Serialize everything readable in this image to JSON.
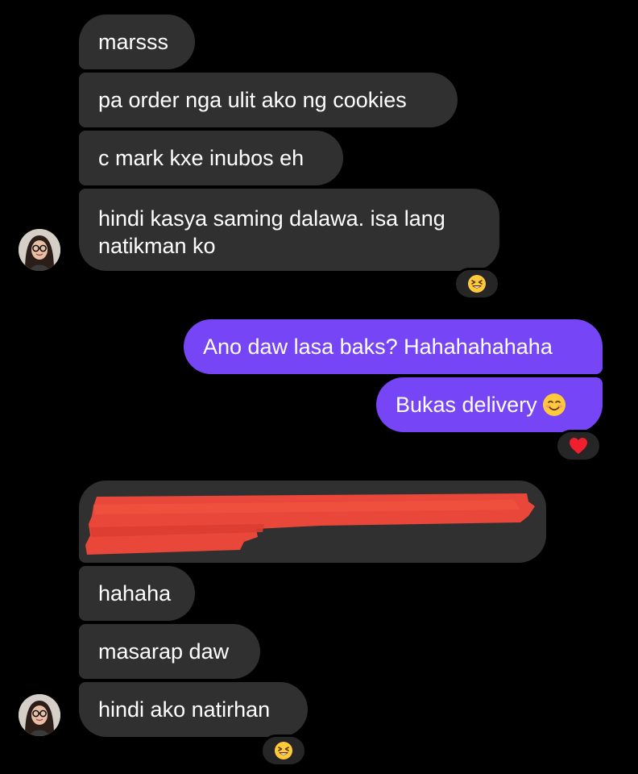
{
  "conversation": {
    "incoming_block_1": [
      {
        "text": "marsss"
      },
      {
        "text": "pa order nga ulit ako ng cookies"
      },
      {
        "text": "c mark kxe inubos eh"
      },
      {
        "lines": [
          "hindi kasya saming dalawa. isa lang",
          "natikman ko"
        ]
      }
    ],
    "incoming_block_1_reaction": "laughing-squinting-emoji",
    "outgoing_block": [
      {
        "text": "Ano daw lasa baks? Hahahahahaha"
      },
      {
        "text": "Bukas delivery",
        "emoji": "smiling-blush-emoji"
      }
    ],
    "outgoing_block_reaction": "red-heart-emoji",
    "incoming_block_2": [
      {
        "redacted": true
      },
      {
        "text": "hahaha"
      },
      {
        "text": "masarap daw"
      },
      {
        "text": "hindi ako natirhan"
      }
    ],
    "incoming_block_2_reaction": "laughing-squinting-emoji"
  },
  "colors": {
    "background": "#000000",
    "incoming_bubble": "#303030",
    "outgoing_bubble": "#7645f6",
    "redaction": "#e8473a",
    "text": "#ffffff"
  }
}
